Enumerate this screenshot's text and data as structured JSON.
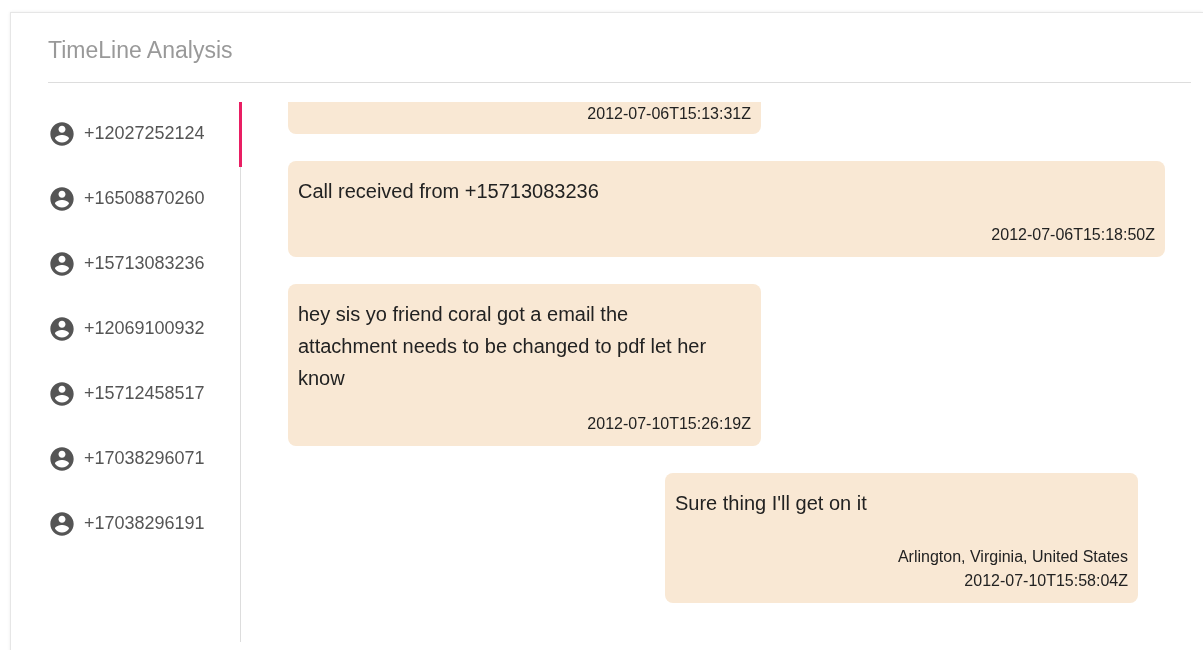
{
  "title": "TimeLine Analysis",
  "contacts": [
    {
      "number": "+12027252124",
      "selected": true
    },
    {
      "number": "+16508870260",
      "selected": false
    },
    {
      "number": "+15713083236",
      "selected": false
    },
    {
      "number": "+12069100932",
      "selected": false
    },
    {
      "number": "+15712458517",
      "selected": false
    },
    {
      "number": "+17038296071",
      "selected": false
    },
    {
      "number": "+17038296191",
      "selected": false
    }
  ],
  "messages": [
    {
      "kind": "cut",
      "outgoing": false,
      "timestamp": "2012-07-06T15:13:31Z"
    },
    {
      "kind": "call",
      "outgoing": false,
      "text": "Call received from +15713083236",
      "timestamp": "2012-07-06T15:18:50Z"
    },
    {
      "kind": "text",
      "outgoing": false,
      "text": "hey sis yo friend coral got a email the attachment needs to be changed to pdf let her know",
      "timestamp": "2012-07-10T15:26:19Z"
    },
    {
      "kind": "text",
      "outgoing": true,
      "text": "Sure thing I'll get on it",
      "location": "Arlington, Virginia, United States",
      "timestamp": "2012-07-10T15:58:04Z"
    }
  ]
}
